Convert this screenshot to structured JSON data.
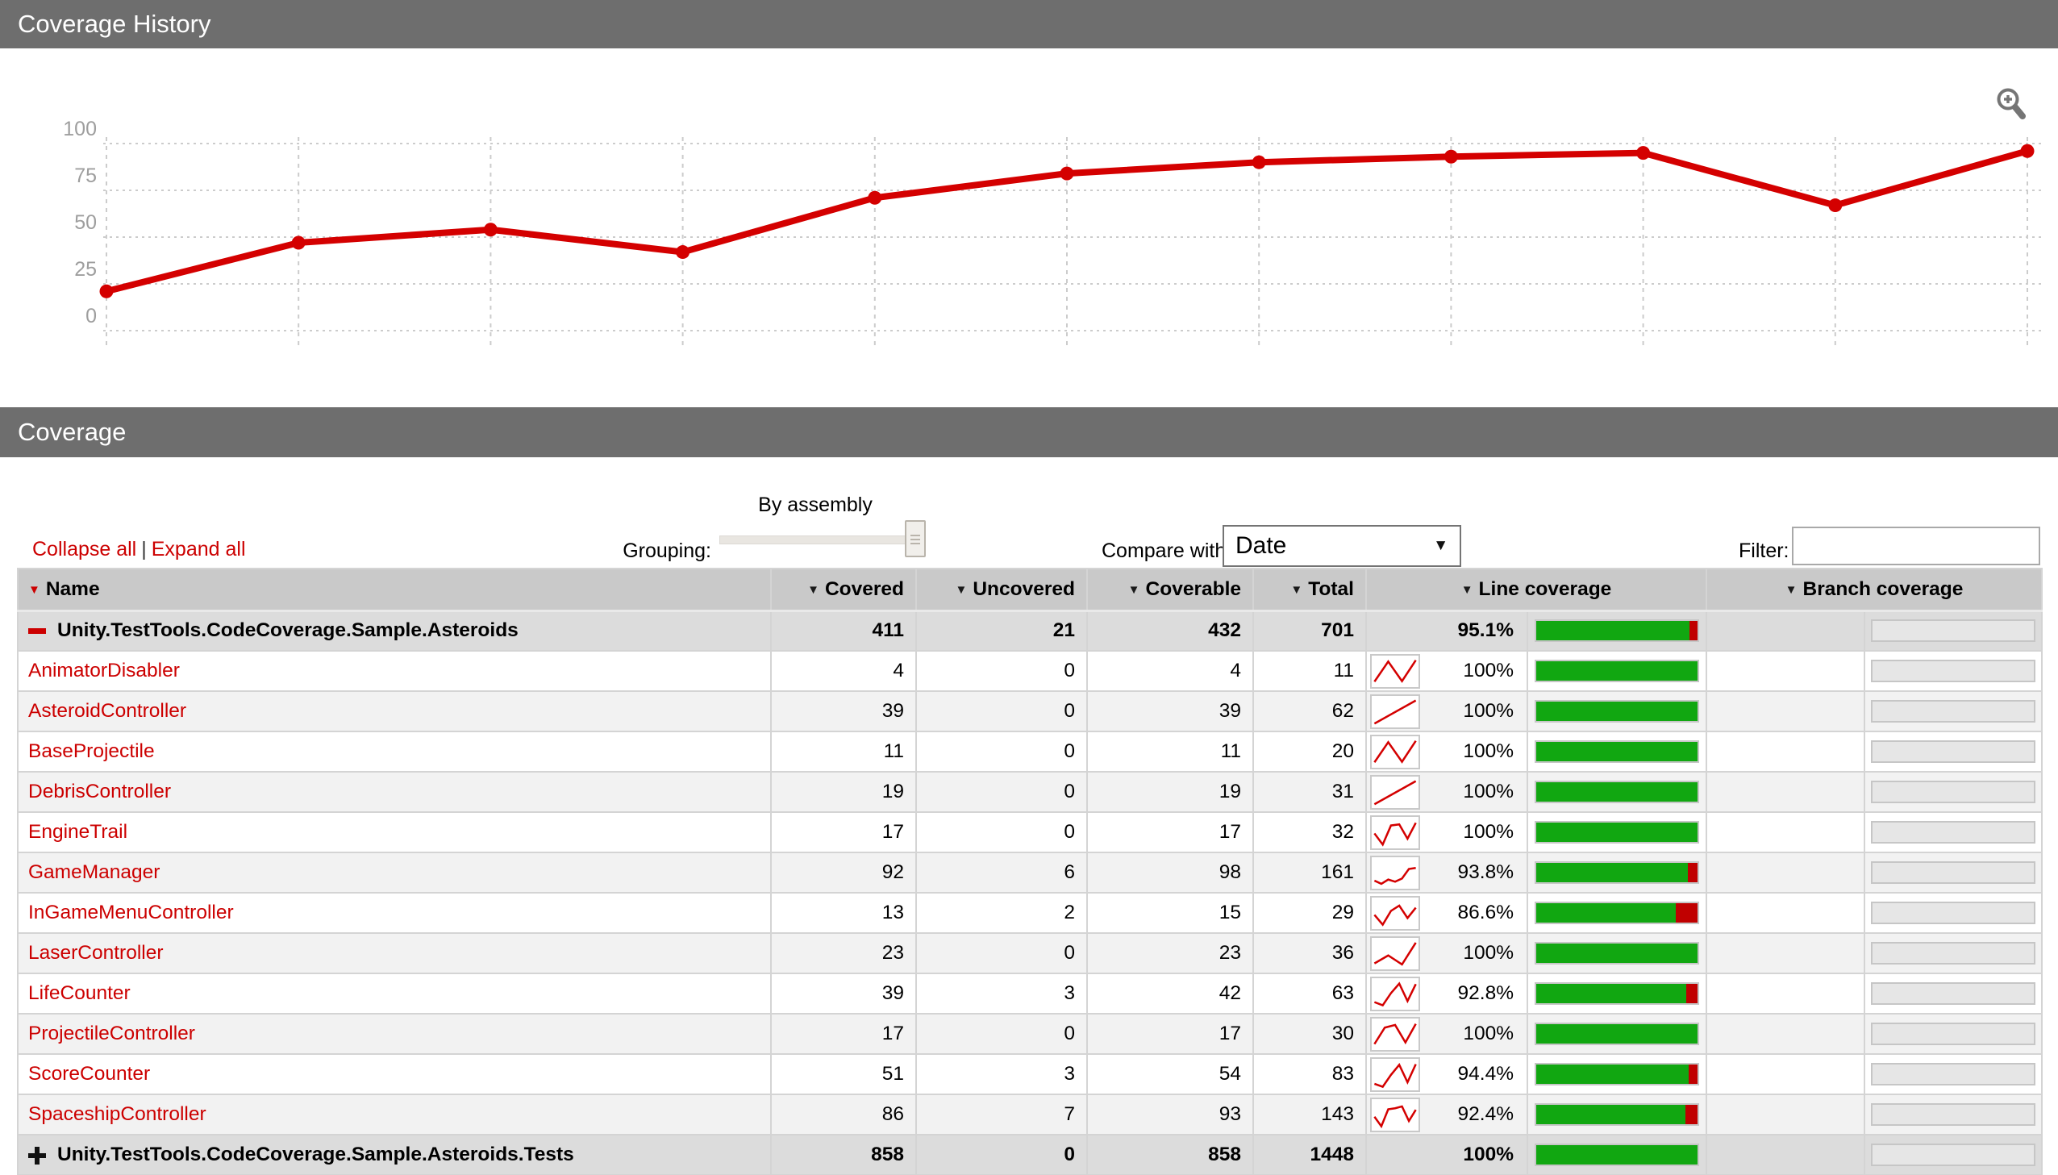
{
  "colors": {
    "accent_red": "#cc0000",
    "chart_red": "#d40000",
    "bar_green": "#11a711",
    "bar_red": "#c00000",
    "section_gray": "#6e6e6e",
    "header_row_gray": "#c9c9c9",
    "group_row_gray": "#dcdcdc",
    "stripe_gray": "#f2f2f2"
  },
  "history": {
    "title": "Coverage History"
  },
  "coverage": {
    "title": "Coverage"
  },
  "chart_data": {
    "type": "line",
    "x": [
      1,
      2,
      3,
      4,
      5,
      6,
      7,
      8,
      9,
      10,
      11
    ],
    "values": [
      21,
      47,
      54,
      42,
      71,
      84,
      90,
      93,
      95,
      67,
      96
    ],
    "title": "Coverage History",
    "xlabel": "",
    "ylabel": "",
    "ylim": [
      0,
      100
    ],
    "yticks": [
      0,
      25,
      50,
      75,
      100
    ],
    "grid": "dotted",
    "legend": "none",
    "series_color": "#d40000"
  },
  "icons": {
    "zoom": "magnifier-plus",
    "sort": "down-triangle",
    "collapse": "red-minus",
    "expand": "black-plus"
  },
  "controls": {
    "collapse_all": "Collapse all",
    "separator": "|",
    "expand_all": "Expand all",
    "grouping_label": "Grouping:",
    "grouping_value": "By assembly",
    "compare_label": "Compare with:",
    "compare_value": "Date",
    "compare_caret": "▼",
    "filter_label": "Filter:",
    "filter_value": "",
    "filter_placeholder": ""
  },
  "table": {
    "columns": [
      {
        "label": "Name"
      },
      {
        "label": "Covered"
      },
      {
        "label": "Uncovered"
      },
      {
        "label": "Coverable"
      },
      {
        "label": "Total"
      },
      {
        "label": "Line coverage"
      },
      {
        "label": "Branch coverage"
      }
    ],
    "rows": [
      {
        "type": "group",
        "toggle": "minus",
        "name": "Unity.TestTools.CodeCoverage.Sample.Asteroids",
        "covered": "411",
        "uncovered": "21",
        "coverable": "432",
        "total": "701",
        "pct": "95.1%",
        "pct_num": 95.1
      },
      {
        "type": "class",
        "name": "AnimatorDisabler",
        "covered": "4",
        "uncovered": "0",
        "coverable": "4",
        "total": "11",
        "pct": "100%",
        "pct_num": 100,
        "history": [
          12,
          88,
          14,
          93
        ]
      },
      {
        "type": "class",
        "name": "AsteroidController",
        "covered": "39",
        "uncovered": "0",
        "coverable": "39",
        "total": "62",
        "pct": "100%",
        "pct_num": 100,
        "history": [
          6,
          93
        ]
      },
      {
        "type": "class",
        "name": "BaseProjectile",
        "covered": "11",
        "uncovered": "0",
        "coverable": "11",
        "total": "20",
        "pct": "100%",
        "pct_num": 100,
        "history": [
          12,
          88,
          14,
          93
        ]
      },
      {
        "type": "class",
        "name": "DebrisController",
        "covered": "19",
        "uncovered": "0",
        "coverable": "19",
        "total": "31",
        "pct": "100%",
        "pct_num": 100,
        "history": [
          6,
          93
        ]
      },
      {
        "type": "class",
        "name": "EngineTrail",
        "covered": "17",
        "uncovered": "0",
        "coverable": "17",
        "total": "32",
        "pct": "100%",
        "pct_num": 100,
        "history": [
          48,
          6,
          78,
          82,
          28,
          88
        ]
      },
      {
        "type": "class",
        "name": "GameManager",
        "covered": "92",
        "uncovered": "6",
        "coverable": "98",
        "total": "161",
        "pct": "93.8%",
        "pct_num": 93.8,
        "history": [
          22,
          10,
          26,
          18,
          30,
          66,
          70
        ]
      },
      {
        "type": "class",
        "name": "InGameMenuController",
        "covered": "13",
        "uncovered": "2",
        "coverable": "15",
        "total": "29",
        "pct": "86.6%",
        "pct_num": 86.6,
        "history": [
          45,
          8,
          60,
          80,
          33,
          72
        ]
      },
      {
        "type": "class",
        "name": "LaserController",
        "covered": "23",
        "uncovered": "0",
        "coverable": "23",
        "total": "36",
        "pct": "100%",
        "pct_num": 100,
        "history": [
          14,
          44,
          10,
          92
        ]
      },
      {
        "type": "class",
        "name": "LifeCounter",
        "covered": "39",
        "uncovered": "3",
        "coverable": "42",
        "total": "63",
        "pct": "92.8%",
        "pct_num": 92.8,
        "history": [
          20,
          8,
          54,
          90,
          24,
          88
        ]
      },
      {
        "type": "class",
        "name": "ProjectileController",
        "covered": "17",
        "uncovered": "0",
        "coverable": "17",
        "total": "30",
        "pct": "100%",
        "pct_num": 100,
        "history": [
          14,
          76,
          86,
          20,
          90
        ]
      },
      {
        "type": "class",
        "name": "ScoreCounter",
        "covered": "51",
        "uncovered": "3",
        "coverable": "54",
        "total": "83",
        "pct": "94.4%",
        "pct_num": 94.4,
        "history": [
          16,
          5,
          50,
          88,
          22,
          90
        ]
      },
      {
        "type": "class",
        "name": "SpaceshipController",
        "covered": "86",
        "uncovered": "7",
        "coverable": "93",
        "total": "143",
        "pct": "92.4%",
        "pct_num": 92.4,
        "history": [
          44,
          8,
          72,
          76,
          83,
          28,
          70
        ]
      },
      {
        "type": "group",
        "toggle": "plus",
        "name": "Unity.TestTools.CodeCoverage.Sample.Asteroids.Tests",
        "covered": "858",
        "uncovered": "0",
        "coverable": "858",
        "total": "1448",
        "pct": "100%",
        "pct_num": 100
      }
    ]
  }
}
